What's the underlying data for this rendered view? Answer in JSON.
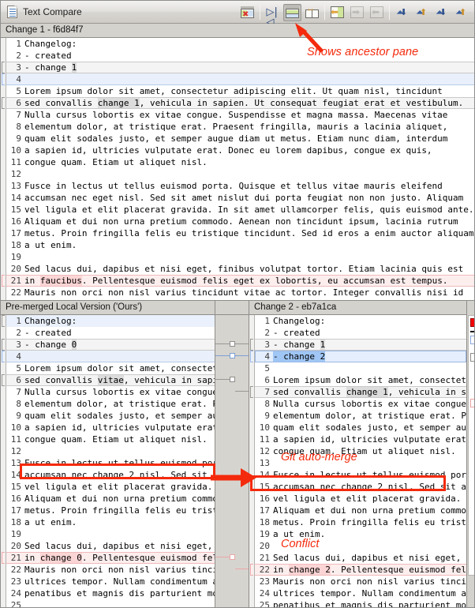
{
  "window": {
    "title": "Text Compare",
    "doc_icon": "document-icon"
  },
  "toolbar": {
    "buttons": [
      {
        "name": "remove-difference-icon",
        "label": "Remove difference"
      },
      {
        "name": "compare-panes-icon",
        "label": "Compare panes"
      },
      {
        "name": "show-ancestor-pane-icon",
        "label": "Show ancestor pane",
        "active": true
      },
      {
        "name": "side-by-side-icon",
        "label": "Side by side"
      },
      {
        "name": "copy-left-icon",
        "label": "Copy to left"
      },
      {
        "name": "copy-right-icon",
        "label": "Copy to right",
        "disabled": true
      },
      {
        "name": "copy-from-right-icon",
        "label": "Copy from right",
        "disabled": true
      },
      {
        "name": "next-difference-icon",
        "label": "Next difference"
      },
      {
        "name": "previous-difference-icon",
        "label": "Previous difference"
      },
      {
        "name": "next-conflict-icon",
        "label": "Next conflict"
      },
      {
        "name": "previous-conflict-icon",
        "label": "Previous conflict"
      }
    ]
  },
  "annotations": [
    {
      "name": "annotation-shows-ancestor-pane",
      "text": "Shows ancestor pane"
    },
    {
      "name": "annotation-git-auto-merge",
      "text": "Git auto-merge"
    },
    {
      "name": "annotation-conflict",
      "text": "Conflict"
    }
  ],
  "top_pane": {
    "title": "Change 1 - f6d84f7",
    "lines": [
      {
        "n": 1,
        "text": "Changelog:"
      },
      {
        "n": 2,
        "text": "- created"
      },
      {
        "n": 3,
        "text": "- change 1",
        "state": "changed",
        "hl": "1",
        "hl_start": 9
      },
      {
        "n": 4,
        "text": "",
        "state": "added"
      },
      {
        "n": 5,
        "text": "Lorem ipsum dolor sit amet, consectetur adipiscing elit. Ut quam nisl, tincidunt"
      },
      {
        "n": 6,
        "text": "sed convallis change 1, vehicula in sapien. Ut consequat feugiat erat et vestibulum.",
        "state": "changed",
        "hl": "change 1",
        "hl_start": 14
      },
      {
        "n": 7,
        "text": "Nulla cursus lobortis ex vitae congue. Suspendisse et magna massa. Maecenas vitae"
      },
      {
        "n": 8,
        "text": "elementum dolor, at tristique erat. Praesent fringilla, mauris a lacinia aliquet,"
      },
      {
        "n": 9,
        "text": "quam elit sodales justo, et semper augue diam ut metus. Etiam nunc diam, interdum"
      },
      {
        "n": 10,
        "text": "a sapien id, ultricies vulputate erat. Donec eu lorem dapibus, congue ex quis,"
      },
      {
        "n": 11,
        "text": "congue quam. Etiam ut aliquet nisl."
      },
      {
        "n": 12,
        "text": ""
      },
      {
        "n": 13,
        "text": "Fusce in lectus ut tellus euismod porta. Quisque et tellus vitae mauris eleifend"
      },
      {
        "n": 14,
        "text": "accumsan nec eget nisl. Sed sit amet nislut dui porta feugiat non non justo. Aliquam"
      },
      {
        "n": 15,
        "text": "vel ligula et elit placerat gravida. In sit amet ullamcorper felis, quis euismod ante."
      },
      {
        "n": 16,
        "text": "Aliquam et dui non urna pretium commodo. Aenean non tincidunt ipsum, lacinia rutrum"
      },
      {
        "n": 17,
        "text": "metus. Proin fringilla felis eu tristique tincidunt. Sed id eros a enim auctor aliquam"
      },
      {
        "n": 18,
        "text": "a ut enim."
      },
      {
        "n": 19,
        "text": ""
      },
      {
        "n": 20,
        "text": "Sed lacus dui, dapibus et nisi eget, finibus volutpat tortor. Etiam lacinia quis est"
      },
      {
        "n": 21,
        "text": "in faucibus. Pellentesque euismod felis eget ex lobortis, eu accumsan est tempus.",
        "state": "conflict",
        "hl": "faucibus",
        "hl_start": 3
      },
      {
        "n": 22,
        "text": "Mauris non orci non nisl varius tincidunt vitae ac tortor. Integer convallis nisi id"
      }
    ]
  },
  "left_pane": {
    "title": "Pre-merged Local Version ('Ours')",
    "lines": [
      {
        "n": 1,
        "text": "Changelog:",
        "state": "caretline"
      },
      {
        "n": 2,
        "text": "- created"
      },
      {
        "n": 3,
        "text": "- change 0",
        "state": "changed",
        "hl": "0",
        "hl_start": 9
      },
      {
        "n": 4,
        "text": "",
        "state": "added"
      },
      {
        "n": 5,
        "text": "Lorem ipsum dolor sit amet, consectet"
      },
      {
        "n": 6,
        "text": "sed convallis vitae, vehicula in sapi",
        "state": "changed",
        "hl": "vitae",
        "hl_start": 14
      },
      {
        "n": 7,
        "text": "Nulla cursus lobortis ex vitae congue"
      },
      {
        "n": 8,
        "text": "elementum dolor, at tristique erat. P"
      },
      {
        "n": 9,
        "text": "quam elit sodales justo, et semper au"
      },
      {
        "n": 10,
        "text": "a sapien id, ultricies vulputate erat"
      },
      {
        "n": 11,
        "text": "congue quam. Etiam ut aliquet nisl."
      },
      {
        "n": 12,
        "text": ""
      },
      {
        "n": 13,
        "text": "Fusce in lectus ut tellus euismod por"
      },
      {
        "n": 14,
        "text": "accumsan nec change 2 nisl. Sed sit a"
      },
      {
        "n": 15,
        "text": "vel ligula et elit placerat gravida."
      },
      {
        "n": 16,
        "text": "Aliquam et dui non urna pretium commo"
      },
      {
        "n": 17,
        "text": "metus. Proin fringilla felis eu trist"
      },
      {
        "n": 18,
        "text": "a ut enim."
      },
      {
        "n": 19,
        "text": ""
      },
      {
        "n": 20,
        "text": "Sed lacus dui, dapibus et nisi eget,"
      },
      {
        "n": 21,
        "text": "in change 0. Pellentesque euismod fel",
        "state": "conflict",
        "hl": "change 0",
        "hl_start": 3
      },
      {
        "n": 22,
        "text": "Mauris non orci non nisl varius tinci"
      },
      {
        "n": 23,
        "text": "ultrices tempor. Nullam condimentum a"
      },
      {
        "n": 24,
        "text": "penatibus et magnis dis parturient mo"
      },
      {
        "n": 25,
        "text": ""
      }
    ]
  },
  "right_pane": {
    "title": "Change 2 - eb7a1ca",
    "lines": [
      {
        "n": 1,
        "text": "Changelog:"
      },
      {
        "n": 2,
        "text": "- created"
      },
      {
        "n": 3,
        "text": "- change 1",
        "state": "changed",
        "hl": "1",
        "hl_start": 9
      },
      {
        "n": 4,
        "text": "- change 2",
        "state": "selected",
        "hl": "- change 2",
        "hl_start": 0
      },
      {
        "n": 5,
        "text": ""
      },
      {
        "n": 6,
        "text": "Lorem ipsum dolor sit amet, consectet"
      },
      {
        "n": 7,
        "text": "sed convallis change 1, vehicula in s",
        "state": "changed",
        "hl": "change 1",
        "hl_start": 14
      },
      {
        "n": 8,
        "text": "Nulla cursus lobortis ex vitae congue"
      },
      {
        "n": 9,
        "text": "elementum dolor, at tristique erat. P"
      },
      {
        "n": 10,
        "text": "quam elit sodales justo, et semper au"
      },
      {
        "n": 11,
        "text": "a sapien id, ultricies vulputate erat"
      },
      {
        "n": 12,
        "text": "congue quam. Etiam ut aliquet nisl."
      },
      {
        "n": 13,
        "text": ""
      },
      {
        "n": 14,
        "text": "Fusce in lectus ut tellus euismod por"
      },
      {
        "n": 15,
        "text": "accumsan nec change 2 nisl. Sed sit a"
      },
      {
        "n": 16,
        "text": "vel ligula et elit placerat gravida."
      },
      {
        "n": 17,
        "text": "Aliquam et dui non urna pretium commo"
      },
      {
        "n": 18,
        "text": "metus. Proin fringilla felis eu trist"
      },
      {
        "n": 19,
        "text": "a ut enim."
      },
      {
        "n": 20,
        "text": ""
      },
      {
        "n": 21,
        "text": "Sed lacus dui, dapibus et nisi eget,"
      },
      {
        "n": 22,
        "text": "in change 2. Pellentesque euismod fel",
        "state": "conflict",
        "hl": "change 2",
        "hl_start": 3
      },
      {
        "n": 23,
        "text": "Mauris non orci non nisl varius tinci"
      },
      {
        "n": 24,
        "text": "ultrices tempor. Nullam condimentum a"
      },
      {
        "n": 25,
        "text": "penatibus et magnis dis parturient mo"
      }
    ]
  },
  "colors": {
    "annotation_red": "#f42a0c",
    "conflict_pink": "#fdeeee",
    "changed_gray": "#f4f4f4",
    "selection_blue": "#9fc6f5",
    "added_blue": "#e9f0fb"
  }
}
